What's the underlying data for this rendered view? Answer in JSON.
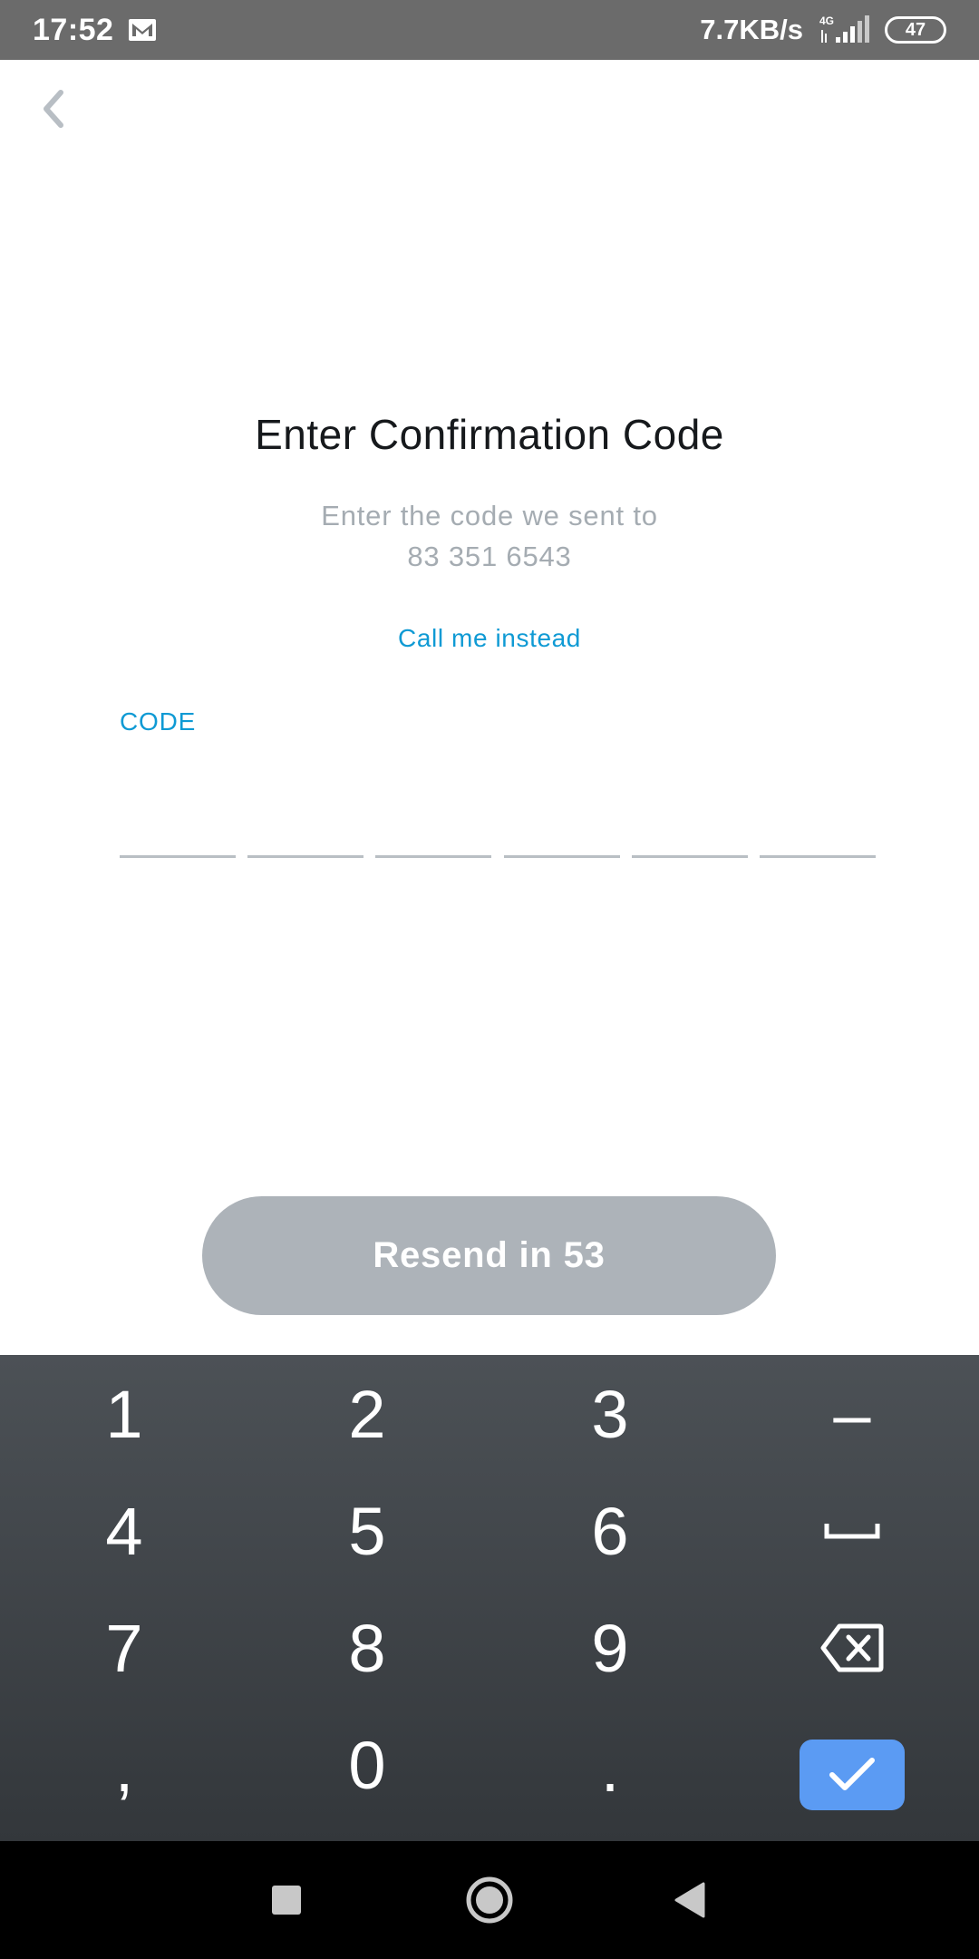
{
  "status_bar": {
    "time": "17:52",
    "network_speed": "7.7KB/s",
    "network_type": "4G",
    "battery": "47",
    "mail_icon": "mail-icon",
    "signal_icon": "signal-icon"
  },
  "header": {
    "back_icon": "chevron-left-icon"
  },
  "main": {
    "title": "Enter Confirmation Code",
    "subtitle_line1": "Enter the code we sent to",
    "subtitle_line2": "83 351 6543",
    "call_link": "Call me instead",
    "code_label": "CODE",
    "code_boxes": [
      "",
      "",
      "",
      "",
      "",
      ""
    ],
    "resend_label": "Resend in 53"
  },
  "keypad": {
    "keys": [
      [
        "1",
        "2",
        "3",
        "–"
      ],
      [
        "4",
        "5",
        "6",
        "space"
      ],
      [
        "7",
        "8",
        "9",
        "backspace"
      ],
      [
        ",",
        "0",
        ".",
        "done"
      ]
    ]
  },
  "colors": {
    "accent": "#0f9ad4",
    "button_disabled": "#adb3b9",
    "done_key": "#5b9bf3",
    "status_bar": "#6b6b6b"
  }
}
